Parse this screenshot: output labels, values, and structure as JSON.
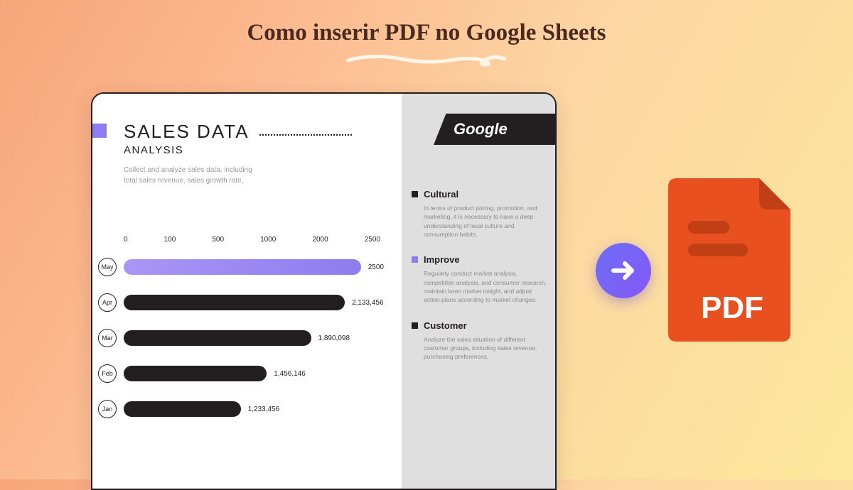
{
  "page_title": "Como inserir PDF no Google Sheets",
  "google_tab": "Google",
  "title_main": "SALES DATA",
  "title_sub": "ANALYSIS",
  "desc": "Collect and analyze sales data, including total sales revenue, sales growth rate,",
  "axis_ticks": [
    "0",
    "100",
    "500",
    "1000",
    "2000",
    "2500"
  ],
  "chart_data": {
    "type": "bar",
    "title": "SALES DATA ANALYSIS",
    "xlabel": "",
    "ylabel": "",
    "xlim": [
      0,
      2500
    ],
    "categories": [
      "May",
      "Apr",
      "Mar",
      "Feb",
      "Jan"
    ],
    "values": [
      2500,
      2133456,
      1890098,
      1456146,
      1233456
    ],
    "display_labels": [
      "2500",
      "2,133,456",
      "1,890,098",
      "1,456,146",
      "1,233,456"
    ],
    "bar_percent": [
      100,
      85,
      72,
      55,
      45
    ],
    "highlight_index": 0
  },
  "side": [
    {
      "title": "Cultural",
      "color": "dark",
      "body": "In terms of product pricing, promotion, and marketing, it is necessary to have a deep understanding of local culture and consumption habits."
    },
    {
      "title": "Improve",
      "color": "purple",
      "body": "Regularly conduct market analysis, competition analysis, and consumer research, maintain keen market insight, and adjust action plans according to market changes."
    },
    {
      "title": "Customer",
      "color": "dark",
      "body": "Analyze the sales situation of different customer groups, including sales revenue, purchasing preferences,"
    }
  ],
  "pdf_label": "PDF"
}
